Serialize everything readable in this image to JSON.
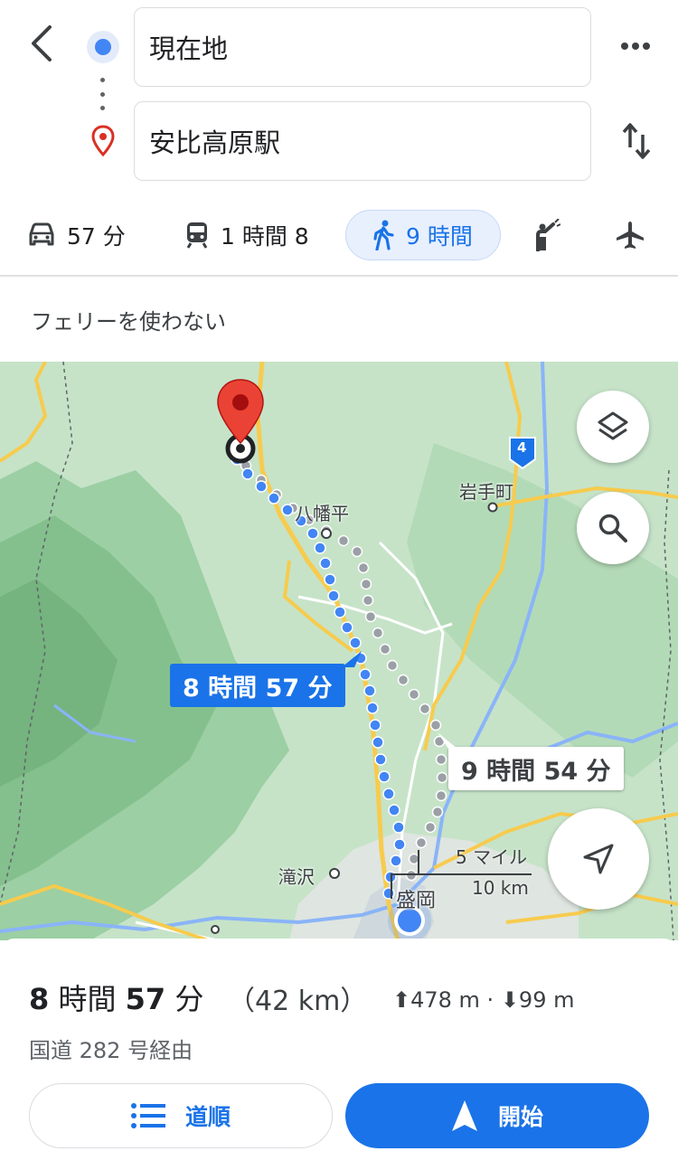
{
  "header": {
    "origin": "現在地",
    "destination": "安比高原駅"
  },
  "modes": [
    {
      "icon": "car-icon",
      "label": "57 分"
    },
    {
      "icon": "train-icon",
      "label": "1 時間 8"
    },
    {
      "icon": "walk-icon",
      "label": "9 時間",
      "selected": true
    },
    {
      "icon": "ride-hail-icon",
      "label": ""
    },
    {
      "icon": "airplane-icon",
      "label": ""
    }
  ],
  "route_option": "フェリーを使わない",
  "map": {
    "place_labels": {
      "hachimantai": "八幡平",
      "iwate_town": "岩手町",
      "takizawa": "滝沢",
      "morioka": "盛岡"
    },
    "road_shield": "4",
    "primary_route_time": "8 時間 57 分",
    "alt_route_time": "9 時間 54 分",
    "scale_miles": "5 マイル",
    "scale_km": "10 km"
  },
  "summary": {
    "duration_hours": "8",
    "duration_hours_unit": "時間",
    "duration_minutes": "57",
    "duration_minutes_unit": "分",
    "distance": "（42 km）",
    "elevation": "⬆478 m · ⬇99 m",
    "via": "国道 282 号経由"
  },
  "buttons": {
    "steps": "道順",
    "start": "開始"
  },
  "colors": {
    "accent": "#1a73e8",
    "route_dot": "#4285f4",
    "alt_route_dot": "#9aa0a6",
    "pin": "#ea4335",
    "map_green": "#c6e3c8",
    "road_yellow": "#f7cb4d"
  }
}
